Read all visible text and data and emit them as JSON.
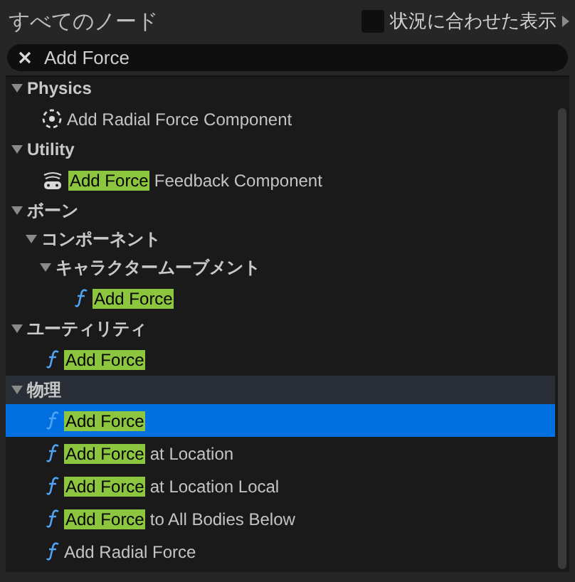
{
  "header": {
    "title": "すべてのノード",
    "context_toggle": {
      "label": "状況に合わせた表示",
      "checked": false
    }
  },
  "search": {
    "value": "Add Force"
  },
  "tree": [
    {
      "kind": "continued",
      "children": [
        {
          "kind": "category",
          "label": "Physics",
          "expanded": true,
          "hovered": false,
          "children": [
            {
              "kind": "radial-component",
              "rest": "Add Radial Force Component",
              "selected": false
            }
          ]
        },
        {
          "kind": "category",
          "label": "Utility",
          "expanded": true,
          "hovered": false,
          "children": [
            {
              "kind": "feedback-component",
              "match": "Add Force",
              "rest": "Feedback Component",
              "selected": false
            }
          ]
        }
      ]
    },
    {
      "kind": "category",
      "label": "ボーン",
      "expanded": true,
      "hovered": false,
      "children": [
        {
          "kind": "category",
          "label": "コンポーネント",
          "expanded": true,
          "hovered": false,
          "children": [
            {
              "kind": "category",
              "label": "キャラクタームーブメント",
              "expanded": true,
              "hovered": false,
              "children": [
                {
                  "kind": "function",
                  "match": "Add Force",
                  "selected": false
                }
              ]
            }
          ]
        }
      ]
    },
    {
      "kind": "category",
      "label": "ユーティリティ",
      "expanded": true,
      "hovered": false,
      "children": [
        {
          "kind": "function",
          "match": "Add Force",
          "selected": false
        }
      ]
    },
    {
      "kind": "category",
      "label": "物理",
      "expanded": true,
      "hovered": true,
      "children": [
        {
          "kind": "function",
          "match": "Add Force",
          "selected": true
        },
        {
          "kind": "function",
          "match": "Add Force",
          "rest": "at Location",
          "selected": false
        },
        {
          "kind": "function",
          "match": "Add Force",
          "rest": "at Location Local",
          "selected": false
        },
        {
          "kind": "function",
          "match": "Add Force",
          "rest": "to All Bodies Below",
          "selected": false
        },
        {
          "kind": "function",
          "rest": "Add Radial Force",
          "selected": false
        }
      ]
    }
  ]
}
